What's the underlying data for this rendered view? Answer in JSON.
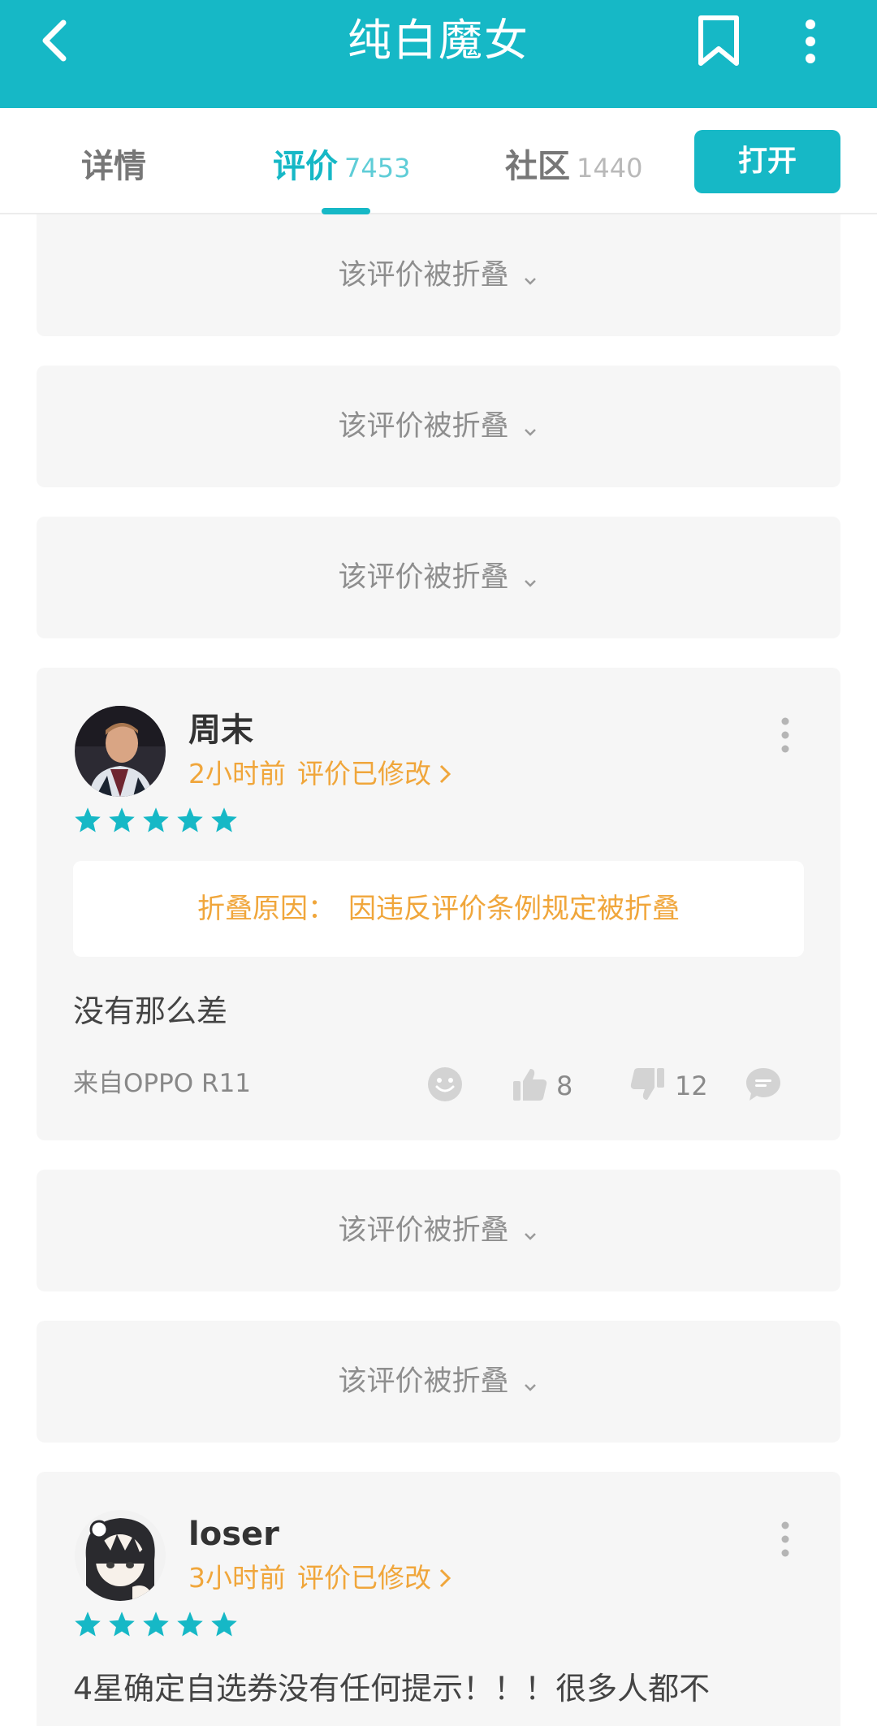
{
  "app": {
    "title": "纯白魔女",
    "icons": {
      "back": "back-icon",
      "bookmark": "bookmark-icon",
      "more": "more-vertical-icon"
    },
    "accent": "#16b8c6",
    "highlight": "#f0a63b"
  },
  "tabs": [
    {
      "label": "详情",
      "count": ""
    },
    {
      "label": "评价",
      "count": "7453",
      "active": true
    },
    {
      "label": "社区",
      "count": "1440"
    }
  ],
  "open_button": "打开",
  "folded_label": "该评价被折叠",
  "reviews": [
    {
      "user": "周末",
      "time": "2小时前",
      "modified": "评价已修改",
      "rating": 5,
      "fold_reason_label": "折叠原因：",
      "fold_reason": "因违反评价条例规定被折叠",
      "text": "没有那么差",
      "device": "来自OPPO R11",
      "likes": "8",
      "dislikes": "12"
    },
    {
      "user": "loser",
      "time": "3小时前",
      "modified": "评价已修改",
      "rating": 5,
      "text": "4星确定自选券没有任何提示！！！很多人都不"
    }
  ]
}
